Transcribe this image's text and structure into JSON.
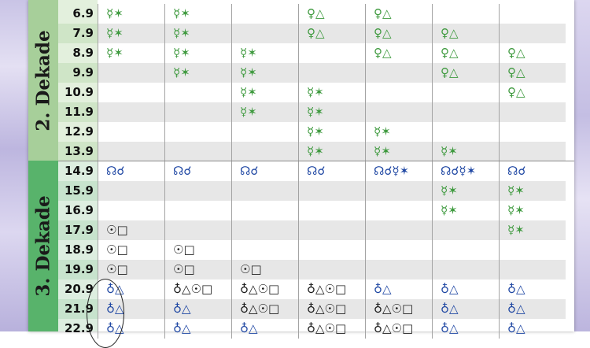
{
  "sections": [
    {
      "label": "2. Dekade"
    },
    {
      "label": "3. Dekade"
    }
  ],
  "rows": [
    {
      "date": "6.9",
      "cells": [
        [
          "☿✶",
          "g"
        ],
        [
          "☿✶",
          "g"
        ],
        [
          "",
          ""
        ],
        [
          "♀△",
          "g"
        ],
        [
          "♀△",
          "g"
        ],
        [
          "",
          ""
        ],
        [
          "",
          ""
        ]
      ]
    },
    {
      "date": "7.9",
      "cells": [
        [
          "☿✶",
          "g"
        ],
        [
          "☿✶",
          "g"
        ],
        [
          "",
          ""
        ],
        [
          "♀△",
          "g"
        ],
        [
          "♀△",
          "g"
        ],
        [
          "♀△",
          "g"
        ],
        [
          "",
          ""
        ]
      ]
    },
    {
      "date": "8.9",
      "cells": [
        [
          "☿✶",
          "g"
        ],
        [
          "☿✶",
          "g"
        ],
        [
          "☿✶",
          "g"
        ],
        [
          "",
          ""
        ],
        [
          "♀△",
          "g"
        ],
        [
          "♀△",
          "g"
        ],
        [
          "♀△",
          "g"
        ]
      ]
    },
    {
      "date": "9.9",
      "cells": [
        [
          "",
          ""
        ],
        [
          "☿✶",
          "g"
        ],
        [
          "☿✶",
          "g"
        ],
        [
          "",
          ""
        ],
        [
          "",
          ""
        ],
        [
          "♀△",
          "g"
        ],
        [
          "♀△",
          "g"
        ]
      ]
    },
    {
      "date": "10.9",
      "cells": [
        [
          "",
          ""
        ],
        [
          "",
          ""
        ],
        [
          "☿✶",
          "g"
        ],
        [
          "☿✶",
          "g"
        ],
        [
          "",
          ""
        ],
        [
          "",
          ""
        ],
        [
          "♀△",
          "g"
        ]
      ]
    },
    {
      "date": "11.9",
      "cells": [
        [
          "",
          ""
        ],
        [
          "",
          ""
        ],
        [
          "☿✶",
          "g"
        ],
        [
          "☿✶",
          "g"
        ],
        [
          "",
          ""
        ],
        [
          "",
          ""
        ],
        [
          "",
          ""
        ]
      ]
    },
    {
      "date": "12.9",
      "cells": [
        [
          "",
          ""
        ],
        [
          "",
          ""
        ],
        [
          "",
          ""
        ],
        [
          "☿✶",
          "g"
        ],
        [
          "☿✶",
          "g"
        ],
        [
          "",
          ""
        ],
        [
          "",
          ""
        ]
      ]
    },
    {
      "date": "13.9",
      "cells": [
        [
          "",
          ""
        ],
        [
          "",
          ""
        ],
        [
          "",
          ""
        ],
        [
          "☿✶",
          "g"
        ],
        [
          "☿✶",
          "g"
        ],
        [
          "☿✶",
          "g"
        ],
        [
          "",
          ""
        ]
      ]
    },
    {
      "date": "14.9",
      "cells": [
        [
          "☊☌",
          "b"
        ],
        [
          "☊☌",
          "b"
        ],
        [
          "☊☌",
          "b"
        ],
        [
          "☊☌",
          "b"
        ],
        [
          "☊☌☿✶",
          "b"
        ],
        [
          "☊☌☿✶",
          "b"
        ],
        [
          "☊☌",
          "b"
        ]
      ]
    },
    {
      "date": "15.9",
      "cells": [
        [
          "",
          ""
        ],
        [
          "",
          ""
        ],
        [
          "",
          ""
        ],
        [
          "",
          ""
        ],
        [
          "",
          ""
        ],
        [
          "☿✶",
          "g"
        ],
        [
          "☿✶",
          "g"
        ]
      ]
    },
    {
      "date": "16.9",
      "cells": [
        [
          "",
          ""
        ],
        [
          "",
          ""
        ],
        [
          "",
          ""
        ],
        [
          "",
          ""
        ],
        [
          "",
          ""
        ],
        [
          "☿✶",
          "g"
        ],
        [
          "☿✶",
          "g"
        ]
      ]
    },
    {
      "date": "17.9",
      "cells": [
        [
          "☉□",
          "k"
        ],
        [
          "",
          ""
        ],
        [
          "",
          ""
        ],
        [
          "",
          ""
        ],
        [
          "",
          ""
        ],
        [
          "",
          ""
        ],
        [
          "☿✶",
          "g"
        ]
      ]
    },
    {
      "date": "18.9",
      "cells": [
        [
          "☉□",
          "k"
        ],
        [
          "☉□",
          "k"
        ],
        [
          "",
          ""
        ],
        [
          "",
          ""
        ],
        [
          "",
          ""
        ],
        [
          "",
          ""
        ],
        [
          "",
          ""
        ]
      ]
    },
    {
      "date": "19.9",
      "cells": [
        [
          "☉□",
          "k"
        ],
        [
          "☉□",
          "k"
        ],
        [
          "☉□",
          "k"
        ],
        [
          "",
          ""
        ],
        [
          "",
          ""
        ],
        [
          "",
          ""
        ],
        [
          "",
          ""
        ]
      ]
    },
    {
      "date": "20.9",
      "cells": [
        [
          "♁△",
          "b"
        ],
        [
          "♁△☉□",
          "k"
        ],
        [
          "♁△☉□",
          "k"
        ],
        [
          "♁△☉□",
          "k"
        ],
        [
          "♁△",
          "b"
        ],
        [
          "♁△",
          "b"
        ],
        [
          "♁△",
          "b"
        ]
      ]
    },
    {
      "date": "21.9",
      "cells": [
        [
          "♁△",
          "b"
        ],
        [
          "♁△",
          "b"
        ],
        [
          "♁△☉□",
          "k"
        ],
        [
          "♁△☉□",
          "k"
        ],
        [
          "♁△☉□",
          "k"
        ],
        [
          "♁△",
          "b"
        ],
        [
          "♁△",
          "b"
        ]
      ]
    },
    {
      "date": "22.9",
      "cells": [
        [
          "♁△",
          "b"
        ],
        [
          "♁△",
          "b"
        ],
        [
          "♁△",
          "b"
        ],
        [
          "♁△☉□",
          "k"
        ],
        [
          "♁△☉□",
          "k"
        ],
        [
          "♁△",
          "b"
        ],
        [
          "♁△",
          "b"
        ]
      ]
    }
  ],
  "colors": {
    "green": "#3f9a3f",
    "blue": "#1f47a3",
    "black": "#1a1a1a",
    "decade2": "#a7cf9a",
    "decade3": "#58b36b"
  }
}
